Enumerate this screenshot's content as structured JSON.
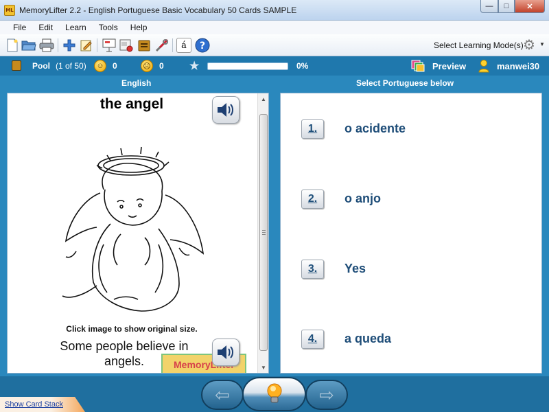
{
  "window": {
    "icon_label": "ML",
    "title": "MemoryLifter 2.2 - English Portuguese Basic Vocabulary 50 Cards SAMPLE",
    "minimize_glyph": "—",
    "maximize_glyph": "□",
    "close_glyph": "✕"
  },
  "menu": [
    "File",
    "Edit",
    "Learn",
    "Tools",
    "Help"
  ],
  "toolbar": {
    "icons": [
      "new-document-icon",
      "open-folder-icon",
      "print-icon",
      "add-card-icon",
      "edit-icon",
      "presentation-icon",
      "card-settings-icon",
      "card-box-icon",
      "tools-icon",
      "character-map-icon",
      "help-icon"
    ],
    "character_map_glyph": "á",
    "learning_mode_label": "Select Learning Mode(s)"
  },
  "status": {
    "pool_label": "Pool",
    "pool_count": "(1 of 50)",
    "correct_count": "0",
    "wrong_count": "0",
    "progress_fraction": 0,
    "progress_text": "0%",
    "preview_label": "Preview",
    "username": "manwei30",
    "accent_color": "#1f78ad"
  },
  "question": {
    "column_header": "English",
    "word": "the angel",
    "click_hint": "Click image to show original size.",
    "example_sentence": "Some people believe in angels.",
    "logo_text": "MemoryLifter"
  },
  "answers": {
    "column_header": "Select Portuguese below",
    "options": [
      {
        "number": "1.",
        "text": "o acidente"
      },
      {
        "number": "2.",
        "text": "o anjo"
      },
      {
        "number": "3.",
        "text": "Yes"
      },
      {
        "number": "4.",
        "text": "a queda"
      }
    ]
  },
  "nav": {
    "back_glyph": "⇦",
    "forward_glyph": "⇨",
    "show_card_stack_label": "Show Card Stack"
  }
}
